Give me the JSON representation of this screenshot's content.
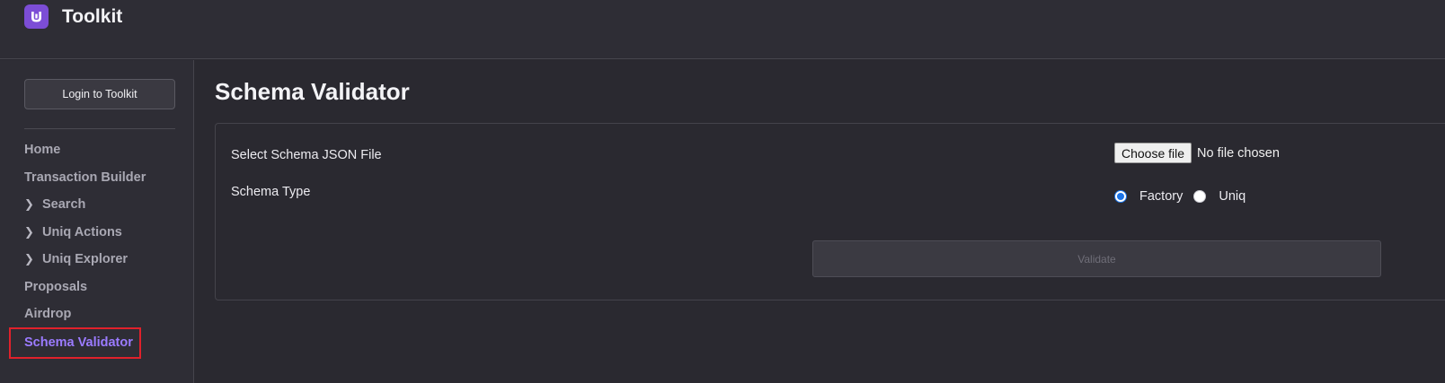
{
  "app": {
    "title": "Toolkit",
    "logo_icon": "U"
  },
  "sidebar": {
    "login_label": "Login to Toolkit",
    "items": [
      {
        "label": "Home",
        "expandable": false
      },
      {
        "label": "Transaction Builder",
        "expandable": false
      },
      {
        "label": "Search",
        "expandable": true
      },
      {
        "label": "Uniq Actions",
        "expandable": true
      },
      {
        "label": "Uniq Explorer",
        "expandable": true
      },
      {
        "label": "Proposals",
        "expandable": false
      },
      {
        "label": "Airdrop",
        "expandable": false
      },
      {
        "label": "Schema Validator",
        "expandable": false,
        "active": true
      }
    ],
    "chevron_icon": "chevron-right-icon",
    "active_color": "#9b7bff",
    "highlight_color": "#e0212b"
  },
  "main": {
    "title": "Schema Validator",
    "file_label": "Select Schema JSON File",
    "file_button": "Choose file",
    "file_status": "No file chosen",
    "type_label": "Schema Type",
    "radio_options": [
      {
        "label": "Factory",
        "checked": true
      },
      {
        "label": "Uniq",
        "checked": false
      }
    ],
    "validate_label": "Validate"
  }
}
